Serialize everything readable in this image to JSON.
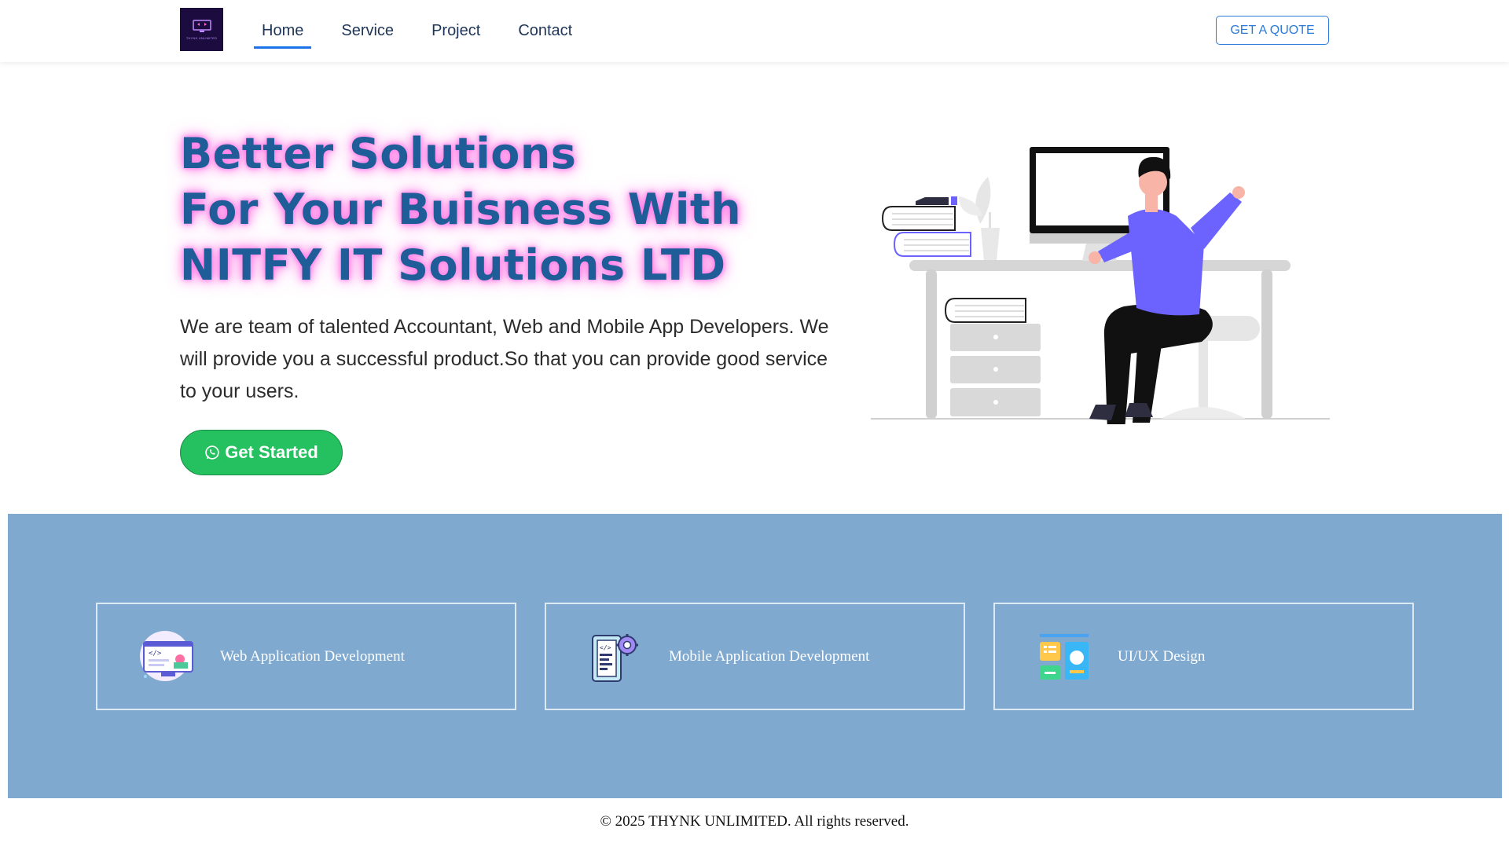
{
  "nav": {
    "logo_text": "THYNK UNLIMITED",
    "links": [
      {
        "label": "Home",
        "active": true
      },
      {
        "label": "Service",
        "active": false
      },
      {
        "label": "Project",
        "active": false
      },
      {
        "label": "Contact",
        "active": false
      }
    ],
    "quote_button": "GET A QUOTE"
  },
  "hero": {
    "title_lines": [
      "Better Solutions",
      "For Your Buisness With",
      "NITFY IT Solutions LTD"
    ],
    "description": "We are team of talented Accountant, Web and Mobile App Developers. We will provide you a successful product.So that you can provide good service to your users.",
    "cta_icon": "whatsapp-icon",
    "cta_label": "Get Started",
    "illustration": "person-at-desk-illustration"
  },
  "services": {
    "items": [
      {
        "label": "Web Application Development",
        "icon": "web-development-icon"
      },
      {
        "label": "Mobile Application Development",
        "icon": "mobile-development-icon"
      },
      {
        "label": "UI/UX Design",
        "icon": "ui-ux-design-icon"
      }
    ]
  },
  "footer": {
    "text": "© 2025 THYNK UNLIMITED. All rights reserved."
  },
  "colors": {
    "title": "#1f5d99",
    "title_glow": "#ff78e6",
    "accent_blue": "#2b7bd8",
    "cta_green": "#25c05f",
    "services_bg": "#80a9cf",
    "illustration_purple": "#6c63ff"
  }
}
